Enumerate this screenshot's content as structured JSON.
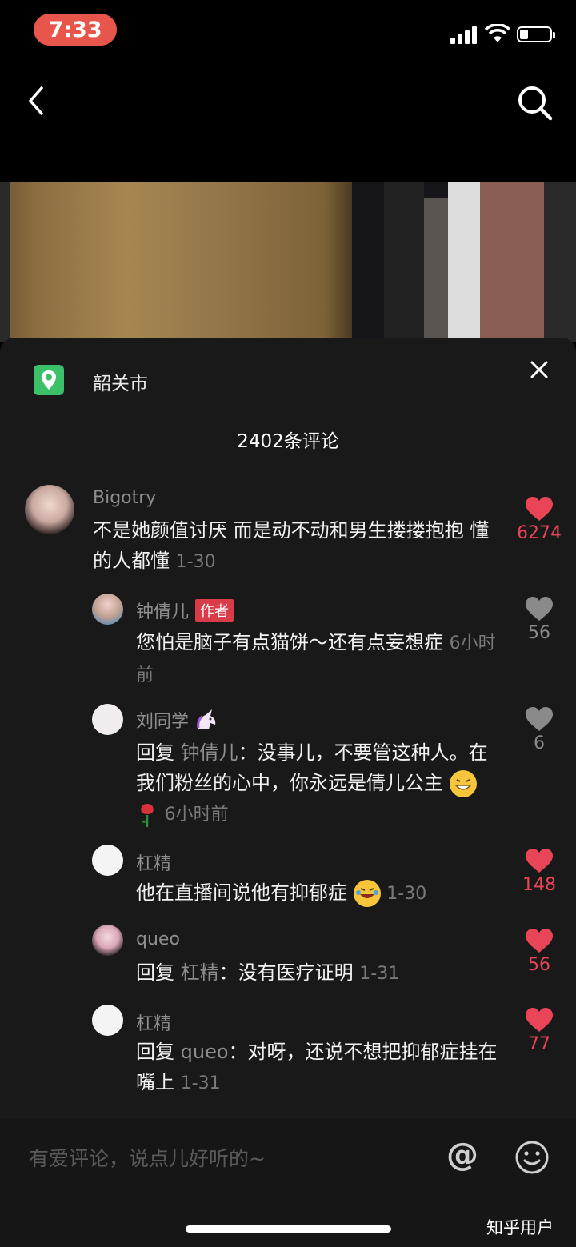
{
  "status_bar": {
    "time": "7:33"
  },
  "location": {
    "city": "韶关市"
  },
  "comments_header": {
    "count_label": "2402条评论"
  },
  "comments": [
    {
      "user": "Bigotry",
      "text": "不是她颜值讨厌 而是动不动和男生搂搂抱抱 懂的人都懂",
      "date": "1-30",
      "likes": "6274",
      "liked": true
    },
    {
      "user": "钟倩儿",
      "badge": "作者",
      "text": "您怕是脑子有点猫饼～还有点妄想症",
      "date": "6小时前",
      "likes": "56",
      "liked": false
    },
    {
      "user": "刘同学",
      "reply_prefix": "回复 ",
      "reply_to": "钟倩儿",
      "text": "：没事儿，不要管这种人。在我们粉丝的心中，你永远是倩儿公主",
      "date": "6小时前",
      "likes": "6",
      "liked": false
    },
    {
      "user": "杠精",
      "text": "他在直播间说他有抑郁症",
      "date": "1-30",
      "likes": "148",
      "liked": true
    },
    {
      "user": "queo",
      "reply_prefix": "回复 ",
      "reply_to": "杠精",
      "text": "：没有医疗证明",
      "date": "1-31",
      "likes": "56",
      "liked": true
    },
    {
      "user": "杠精",
      "reply_prefix": "回复 ",
      "reply_to": "queo",
      "text": "：对呀，还说不想把抑郁症挂在嘴上",
      "date": "1-31",
      "likes": "77",
      "liked": true
    }
  ],
  "input": {
    "placeholder": "有爱评论，说点儿好听的~",
    "at_symbol": "@"
  },
  "watermark": "知乎用户",
  "colors": {
    "like_red": "#e94458",
    "sheet_bg": "#191919"
  }
}
